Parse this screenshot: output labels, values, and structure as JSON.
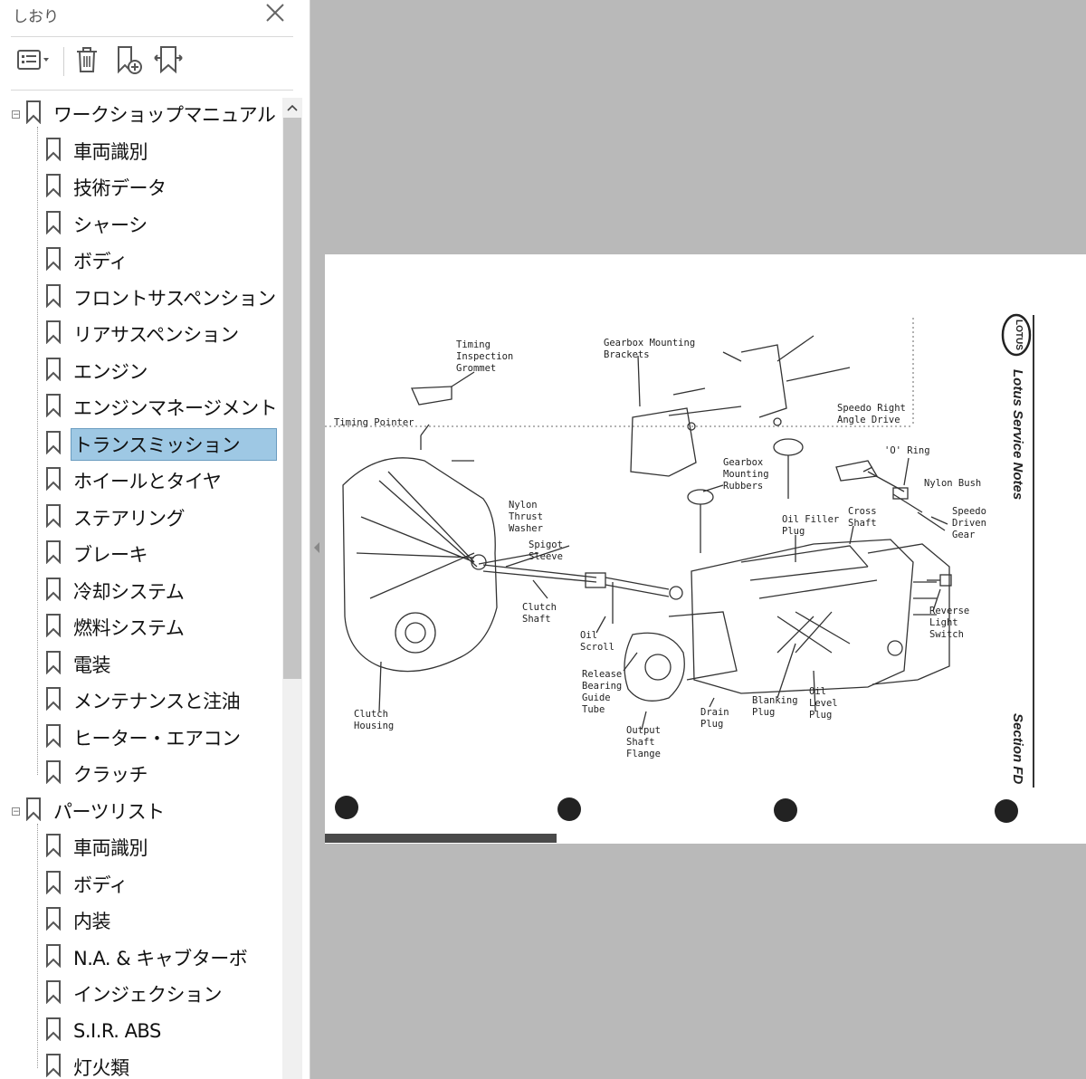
{
  "panel": {
    "title": "しおり",
    "close_icon": "close-icon",
    "toolbar": [
      {
        "name": "options-menu-button",
        "icon": "list-options-icon"
      },
      {
        "name": "delete-bookmark-button",
        "icon": "trash-icon"
      },
      {
        "name": "new-bookmark-button",
        "icon": "bookmark-add-icon"
      },
      {
        "name": "expand-bookmark-button",
        "icon": "bookmark-expand-icon"
      }
    ]
  },
  "bookmarks": {
    "groups": [
      {
        "label": "ワークショップマニュアル",
        "expanded": true,
        "items": [
          "車両識別",
          "技術データ",
          "シャーシ",
          "ボディ",
          "フロントサスペンション",
          "リアサスペンション",
          "エンジン",
          "エンジンマネージメント",
          "トランスミッション",
          "ホイールとタイヤ",
          "ステアリング",
          "ブレーキ",
          "冷却システム",
          "燃料システム",
          "電装",
          "メンテナンスと注油",
          "ヒーター・エアコン",
          "クラッチ"
        ]
      },
      {
        "label": "パーツリスト",
        "expanded": true,
        "items": [
          "車両識別",
          "ボディ",
          "内装",
          "N.A. & キャブターボ",
          "インジェクション",
          "S.I.R. ABS",
          "灯火類"
        ]
      }
    ],
    "selected": "トランスミッション"
  },
  "document": {
    "side_brand": "Lotus Service Notes",
    "section": "Section FD",
    "logo_text": "LOTUS",
    "labels": [
      "Timing\nInspection\nGrommet",
      "Gearbox Mounting\nBrackets",
      "Timing Pointer",
      "Speedo Right\nAngle Drive",
      "'O' Ring",
      "Gearbox\nMounting\nRubbers",
      "Nylon Bush",
      "Nylon\nThrust\nWasher",
      "Spigot\nSleeve",
      "Oil Filler\nPlug",
      "Cross\nShaft",
      "Speedo\nDriven\nGear",
      "Clutch\nShaft",
      "Oil\nScroll",
      "Reverse\nLight\nSwitch",
      "Release\nBearing\nGuide\nTube",
      "Clutch\nHousing",
      "Drain\nPlug",
      "Blanking\nPlug",
      "Oil\nLevel\nPlug",
      "Output\nShaft\nFlange"
    ]
  }
}
